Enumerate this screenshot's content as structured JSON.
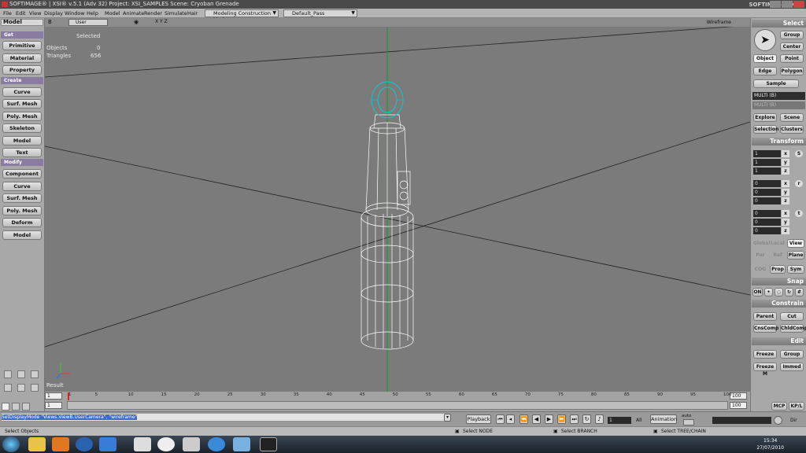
{
  "window": {
    "title": "SOFTIMAGE® | XSI® v.5.1 (Adv 32) Project: XSI_SAMPLES   Scene: Cryoban Grenade",
    "watermark": "SOFTIMAGE | XSI"
  },
  "menubar": {
    "items": [
      "File",
      "Edit",
      "View",
      "Display",
      "Window",
      "Help",
      "Model",
      "Animate",
      "Render",
      "Simulate",
      "Hair"
    ],
    "construction_mode": "Modeling Construction Mode",
    "render_pass": "Default_Pass"
  },
  "left_panel": {
    "module": "Model",
    "get_header": "Get",
    "get_buttons": [
      "Primitive",
      "Material",
      "Property"
    ],
    "create_header": "Create",
    "create_buttons": [
      "Curve",
      "Surf. Mesh",
      "Poly. Mesh",
      "Skeleton",
      "Model",
      "Text"
    ],
    "modify_header": "Modify",
    "modify_buttons": [
      "Component",
      "Curve",
      "Surf. Mesh",
      "Poly. Mesh",
      "Deform",
      "Model"
    ]
  },
  "viewport": {
    "letter": "B",
    "camera": "User",
    "axes_toggle": "X Y Z",
    "display_mode": "Wireframe",
    "stats_header": "Selected",
    "stats": [
      {
        "label": "Objects",
        "value": "0"
      },
      {
        "label": "Triangles",
        "value": "656"
      }
    ],
    "result_label": "Result"
  },
  "right_panel": {
    "select_header": "Select",
    "select_buttons": [
      "Group",
      "Center",
      "Object",
      "Point",
      "Edge",
      "Polygon",
      "Sample"
    ],
    "multi_primary": "MULTI (B)",
    "multi_secondary": "MULTI (B)",
    "explore_buttons": [
      "Explore",
      "Scene",
      "Selection",
      "Clusters"
    ],
    "transform_header": "Transform",
    "scale": {
      "x": "1",
      "y": "1",
      "z": "1",
      "key": "S"
    },
    "rotate": {
      "x": "0",
      "y": "0",
      "z": "0",
      "key": "r"
    },
    "translate": {
      "x": "0",
      "y": "0",
      "z": "0",
      "key": "t"
    },
    "ref_modes": [
      "Global",
      "Local",
      "View",
      "Par",
      "Ref",
      "Plane"
    ],
    "cog_buttons": [
      "COG",
      "Prop",
      "Sym"
    ],
    "snap_header": "Snap",
    "snap_on": "ON",
    "constrain_header": "Constrain",
    "constrain_buttons": [
      "Parent",
      "Cut",
      "CnsComp",
      "ChldComp"
    ],
    "edit_header": "Edit",
    "edit_buttons": [
      "Freeze",
      "Group",
      "Freeze M",
      "Immed"
    ],
    "bottom_tabs": [
      "MCP",
      "KP/L"
    ]
  },
  "timeline": {
    "start": "1",
    "start2": "1",
    "end": "100",
    "end2": "100",
    "ticks": [
      "1",
      "5",
      "10",
      "15",
      "20",
      "25",
      "30",
      "35",
      "40",
      "45",
      "50",
      "55",
      "60",
      "65",
      "70",
      "75",
      "80",
      "85",
      "90",
      "95",
      "100"
    ]
  },
  "command_bar": {
    "command": "SetDisplayMode \"Views.ViewB.UserCamera\", \"wireframe\"",
    "playback_label": "Playback",
    "frame_value": "1",
    "all_label": "All",
    "animation_label": "Animation",
    "auto_label": "auto",
    "dir_label": "Dir"
  },
  "status_bar": {
    "mode": "Select Objects",
    "hint_left": "Select NODE",
    "hint_middle": "Select BRANCH",
    "hint_right": "Select TREE/CHAIN"
  },
  "taskbar": {
    "time": "15:34",
    "date": "27/07/2010"
  },
  "colors": {
    "viewport_bg": "#7b7b7b",
    "panel_bg": "#a8a8a8",
    "section_header": "#8a7ca0",
    "selection_highlight": "#3d6ac8",
    "wireframe": "#ffffff",
    "selected_wire": "#00d0d0",
    "y_axis": "#1a9a1a"
  }
}
